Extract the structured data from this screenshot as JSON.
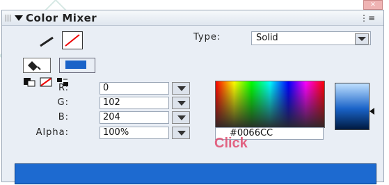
{
  "panel": {
    "title": "Color Mixer",
    "menu_icon": "options-menu-icon"
  },
  "type": {
    "label": "Type:",
    "value": "Solid"
  },
  "fields": {
    "r": {
      "label": "R:",
      "value": "0"
    },
    "g": {
      "label": "G:",
      "value": "102"
    },
    "b": {
      "label": "B:",
      "value": "204"
    },
    "alpha": {
      "label": "Alpha:",
      "value": "100%"
    }
  },
  "hex": {
    "value": "#0066CC"
  },
  "watermark": {
    "text": "Click"
  },
  "colors": {
    "fill": "#0066CC",
    "preview": "#1D6AD0"
  }
}
